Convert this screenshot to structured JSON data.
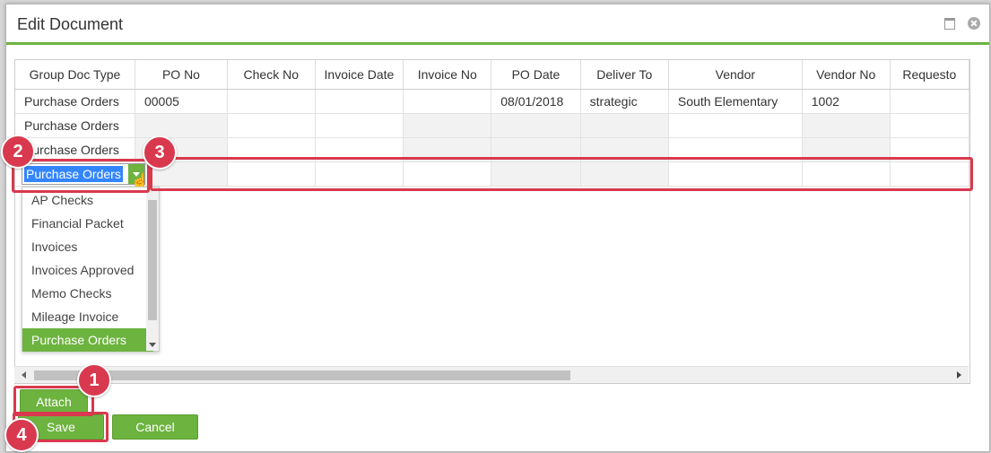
{
  "dialog": {
    "title": "Edit Document"
  },
  "grid": {
    "columns": [
      "Group Doc Type",
      "PO No",
      "Check No",
      "Invoice Date",
      "Invoice No",
      "PO Date",
      "Deliver To",
      "Vendor",
      "Vendor No",
      "Requesto"
    ],
    "rows": [
      [
        "Purchase Orders",
        "00005",
        "",
        "",
        "",
        "08/01/2018",
        "strategic",
        "South Elementary",
        "1002",
        ""
      ],
      [
        "Purchase Orders",
        "",
        "",
        "",
        "",
        "",
        "",
        "",
        "",
        ""
      ],
      [
        "Purchase Orders",
        "",
        "",
        "",
        "",
        "",
        "",
        "",
        "",
        ""
      ]
    ]
  },
  "editor": {
    "selected_value": "Purchase Orders",
    "options": [
      "AP Checks",
      "Financial Packet",
      "Invoices",
      "Invoices Approved",
      "Memo Checks",
      "Mileage Invoice",
      "Purchase Orders"
    ],
    "selected_option": "Purchase Orders"
  },
  "buttons": {
    "attach": "Attach",
    "save": "Save",
    "cancel": "Cancel"
  },
  "callouts": [
    "1",
    "2",
    "3",
    "4"
  ],
  "colors": {
    "accent": "#6db33f",
    "callout": "#d9394e",
    "selection": "#3385ff"
  }
}
